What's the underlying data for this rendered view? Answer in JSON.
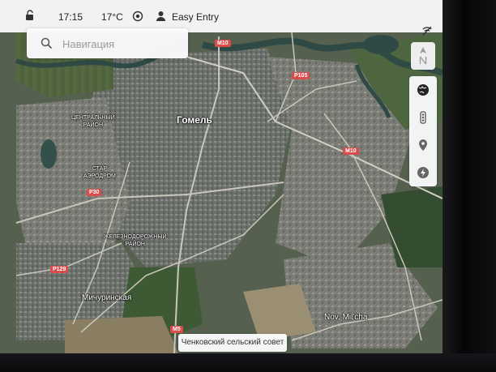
{
  "status_bar": {
    "time": "17:15",
    "temperature": "17°C",
    "profile_name": "Easy Entry"
  },
  "search": {
    "placeholder": "Навигация"
  },
  "map": {
    "labels": {
      "city": "Гомель",
      "district_central_1": "ЦЕНТРАЛЬНЫЙ",
      "district_central_2": "РАЙОН",
      "district_airport_1": "СТАР",
      "district_airport_2": "АЭРОДРОМ",
      "district_rail_1": "ЖЕЛЕЗНОДОРОЖНЫЙ",
      "district_rail_2": "РАЙОН",
      "town_michurinskaya": "Мичуринская",
      "town_novmilcha": "Nov. Mil'cha"
    },
    "road_shields": {
      "m10_top": "M10",
      "p105": "P105",
      "m10_right": "M10",
      "p30": "P30",
      "p129": "P129",
      "m5": "M5"
    }
  },
  "popup": {
    "place_name": "Ченковский сельский совет"
  },
  "colors": {
    "road_shield": "#d94c4c",
    "water": "#2f4a44"
  },
  "icons": {
    "lock": "lock-icon",
    "sentry": "sentry-icon",
    "profile": "profile-icon",
    "search": "search-icon",
    "wifi_off": "wifi-off-icon",
    "north": "north-up-icon",
    "globe": "globe-icon",
    "traffic": "traffic-icon",
    "location": "location-pin-icon",
    "charging": "charging-bolt-icon"
  }
}
